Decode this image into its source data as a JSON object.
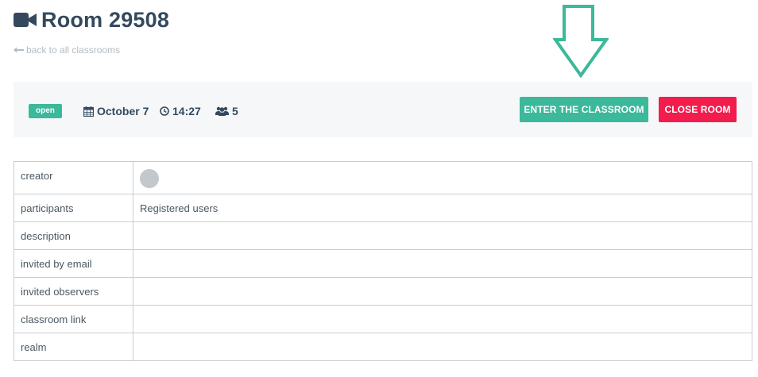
{
  "header": {
    "title": "Room 29508",
    "title_icon": "video-camera-icon",
    "back_link": "back to all classrooms"
  },
  "info_bar": {
    "status": "open",
    "date": "October 7",
    "time": "14:27",
    "participants_count": "5",
    "enter_button": "ENTER THE CLASSROOM",
    "close_button": "CLOSE ROOM"
  },
  "colors": {
    "accent": "#3cb89a",
    "danger": "#f21c4d",
    "text": "#34495e"
  },
  "details": {
    "rows": [
      {
        "label": "creator",
        "value": ""
      },
      {
        "label": "participants",
        "value": "Registered users"
      },
      {
        "label": "description",
        "value": ""
      },
      {
        "label": "invited by email",
        "value": ""
      },
      {
        "label": "invited observers",
        "value": ""
      },
      {
        "label": "classroom link",
        "value": ""
      },
      {
        "label": "realm",
        "value": ""
      }
    ]
  }
}
